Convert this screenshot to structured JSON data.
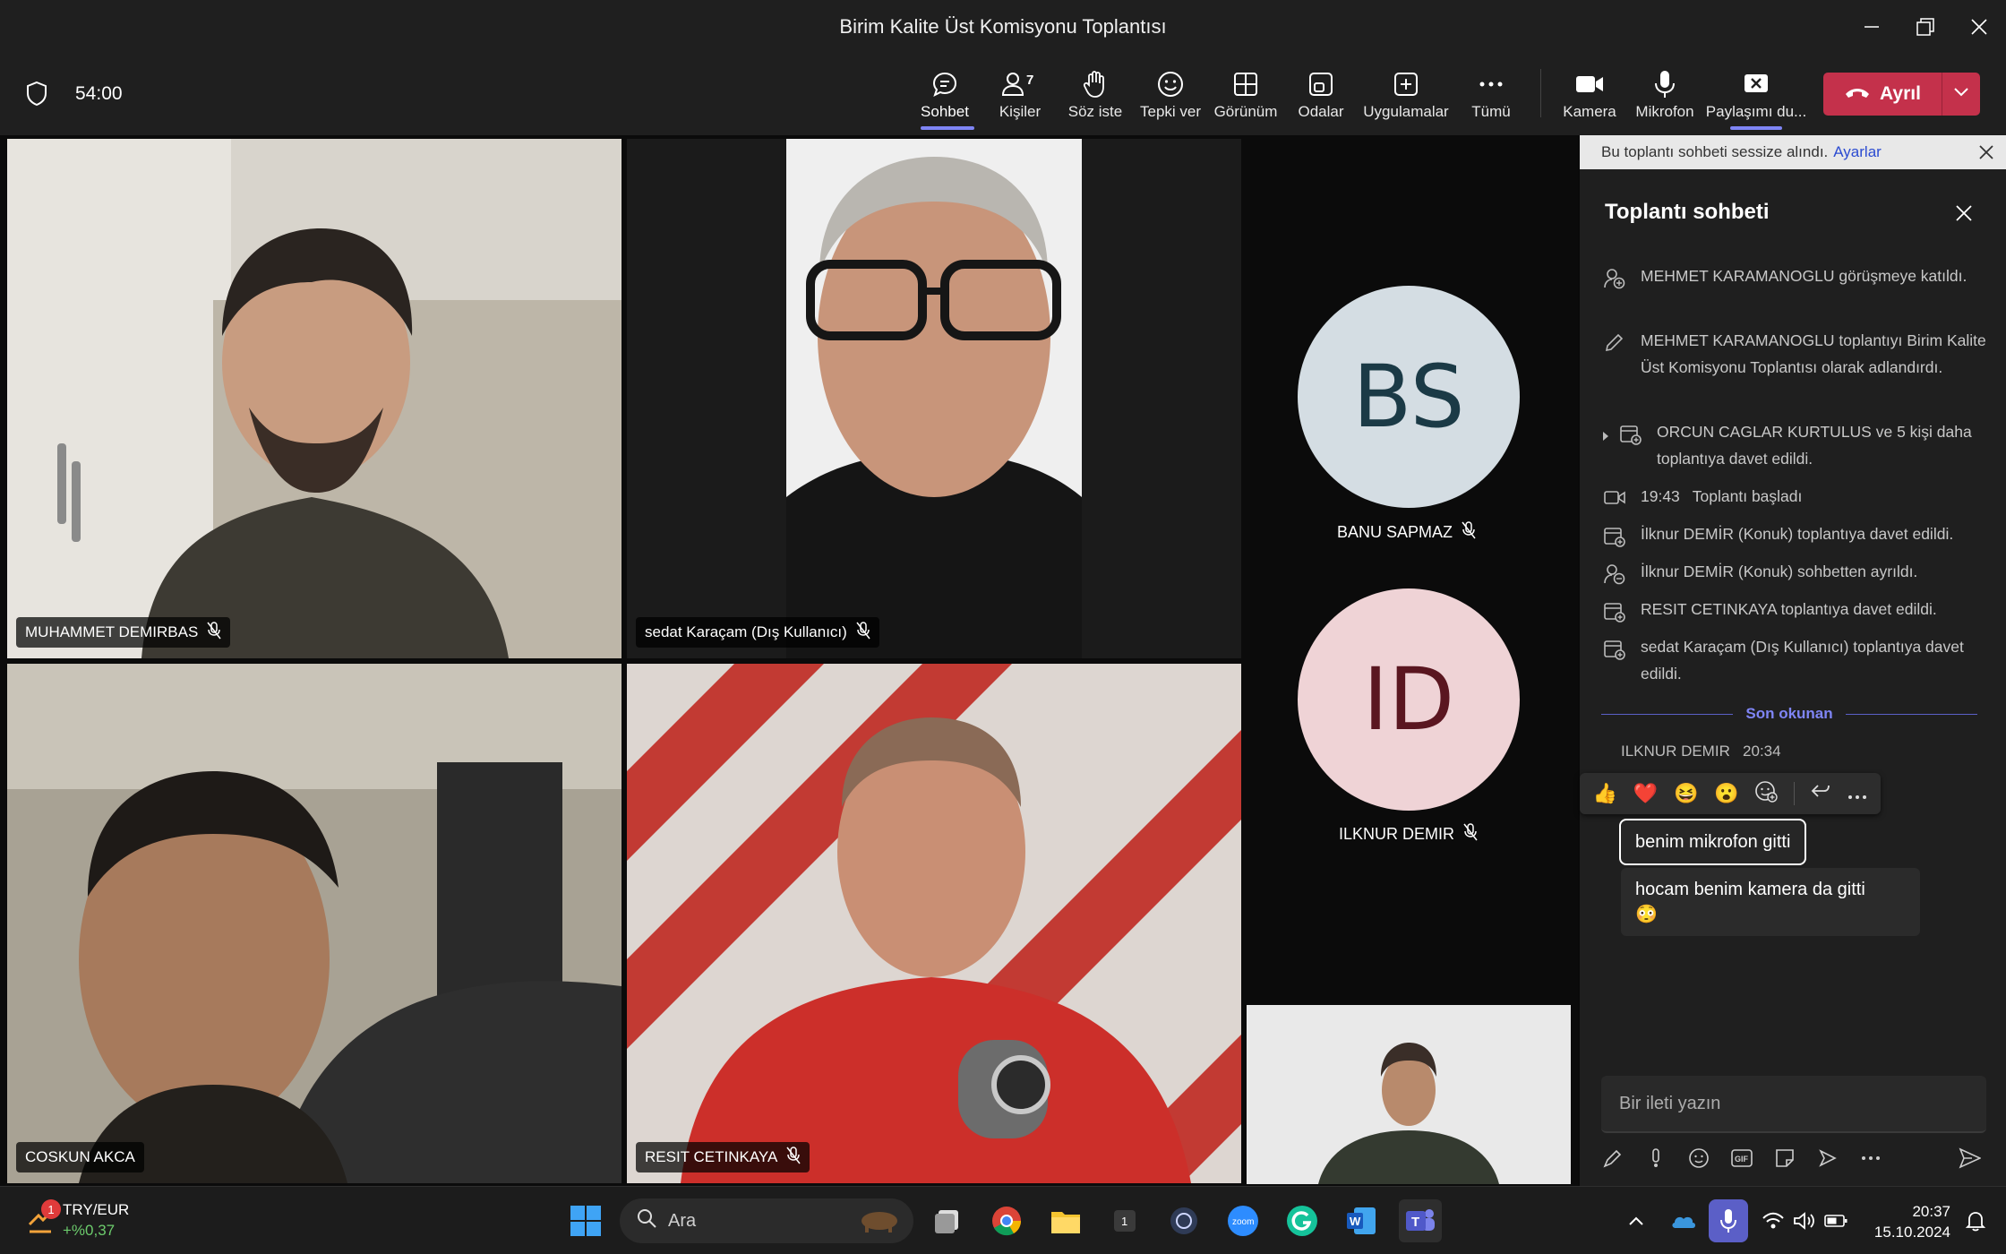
{
  "window": {
    "title": "Birim Kalite Üst Komisyonu Toplantısı"
  },
  "toolbar": {
    "timer": "54:00",
    "buttons": [
      {
        "label": "Sohbet",
        "icon": "chat-icon"
      },
      {
        "label": "Kişiler",
        "icon": "people-icon",
        "badge": "7"
      },
      {
        "label": "Söz iste",
        "icon": "raise-hand-icon"
      },
      {
        "label": "Tepki ver",
        "icon": "emoji-icon"
      },
      {
        "label": "Görünüm",
        "icon": "grid-icon"
      },
      {
        "label": "Odalar",
        "icon": "rooms-icon"
      },
      {
        "label": "Uygulamalar",
        "icon": "plus-icon"
      },
      {
        "label": "Tümü",
        "icon": "more-icon"
      }
    ],
    "media": [
      {
        "label": "Kamera",
        "icon": "camera-icon"
      },
      {
        "label": "Mikrofon",
        "icon": "microphone-icon"
      },
      {
        "label": "Paylaşımı du...",
        "icon": "stop-share-icon"
      }
    ],
    "leave_label": "Ayrıl"
  },
  "participants": {
    "p1": "MUHAMMET DEMIRBAS",
    "p2": "sedat Karaçam (Dış Kullanıcı)",
    "p3": "COSKUN AKCA",
    "p4": "RESIT CETINKAYA",
    "avatar1": {
      "initials": "BS",
      "name": "BANU SAPMAZ",
      "color": "#d4dde3",
      "text_color": "#1b3a46"
    },
    "avatar2": {
      "initials": "ID",
      "name": "ILKNUR DEMIR",
      "color": "#efd3d6",
      "text_color": "#5a1620"
    }
  },
  "chat": {
    "banner_text": "Bu toplantı sohbeti sessize alındı.",
    "banner_link": "Ayarlar",
    "title": "Toplantı sohbeti",
    "events": [
      {
        "icon": "person-add-icon",
        "text": "MEHMET KARAMANOGLU görüşmeye katıldı."
      },
      {
        "icon": "pencil-icon",
        "text": "MEHMET KARAMANOGLU toplantıyı Birim Kalite Üst Komisyonu Toplantısı olarak adlandırdı."
      },
      {
        "icon": "calendar-add-icon",
        "text": "ORCUN CAGLAR KURTULUS ve 5 kişi daha toplantıya davet edildi."
      },
      {
        "icon": "video-icon",
        "time": "19:43",
        "text": "Toplantı başladı"
      },
      {
        "icon": "calendar-add-icon",
        "text": "İlknur DEMİR (Konuk) toplantıya davet edildi."
      },
      {
        "icon": "person-leave-icon",
        "text": "İlknur DEMİR (Konuk) sohbetten ayrıldı."
      },
      {
        "icon": "calendar-add-icon",
        "text": "RESIT CETINKAYA toplantıya davet edildi."
      },
      {
        "icon": "calendar-add-icon",
        "text": "sedat Karaçam (Dış Kullanıcı) toplantıya davet edildi."
      }
    ],
    "last_read": "Son okunan",
    "message_author": "ILKNUR DEMIR",
    "message_time": "20:34",
    "reactions": [
      "👍",
      "❤️",
      "😆",
      "😮"
    ],
    "messages": [
      "benim mikrofon gitti",
      "hocam benim kamera da gitti"
    ],
    "message2_emoji": "😳",
    "composer_placeholder": "Bir ileti yazın"
  },
  "taskbar": {
    "widget_title": "TRY/EUR",
    "widget_value": "+%0,37",
    "widget_badge": "1",
    "search_label": "Ara",
    "time": "20:37",
    "date": "15.10.2024"
  }
}
